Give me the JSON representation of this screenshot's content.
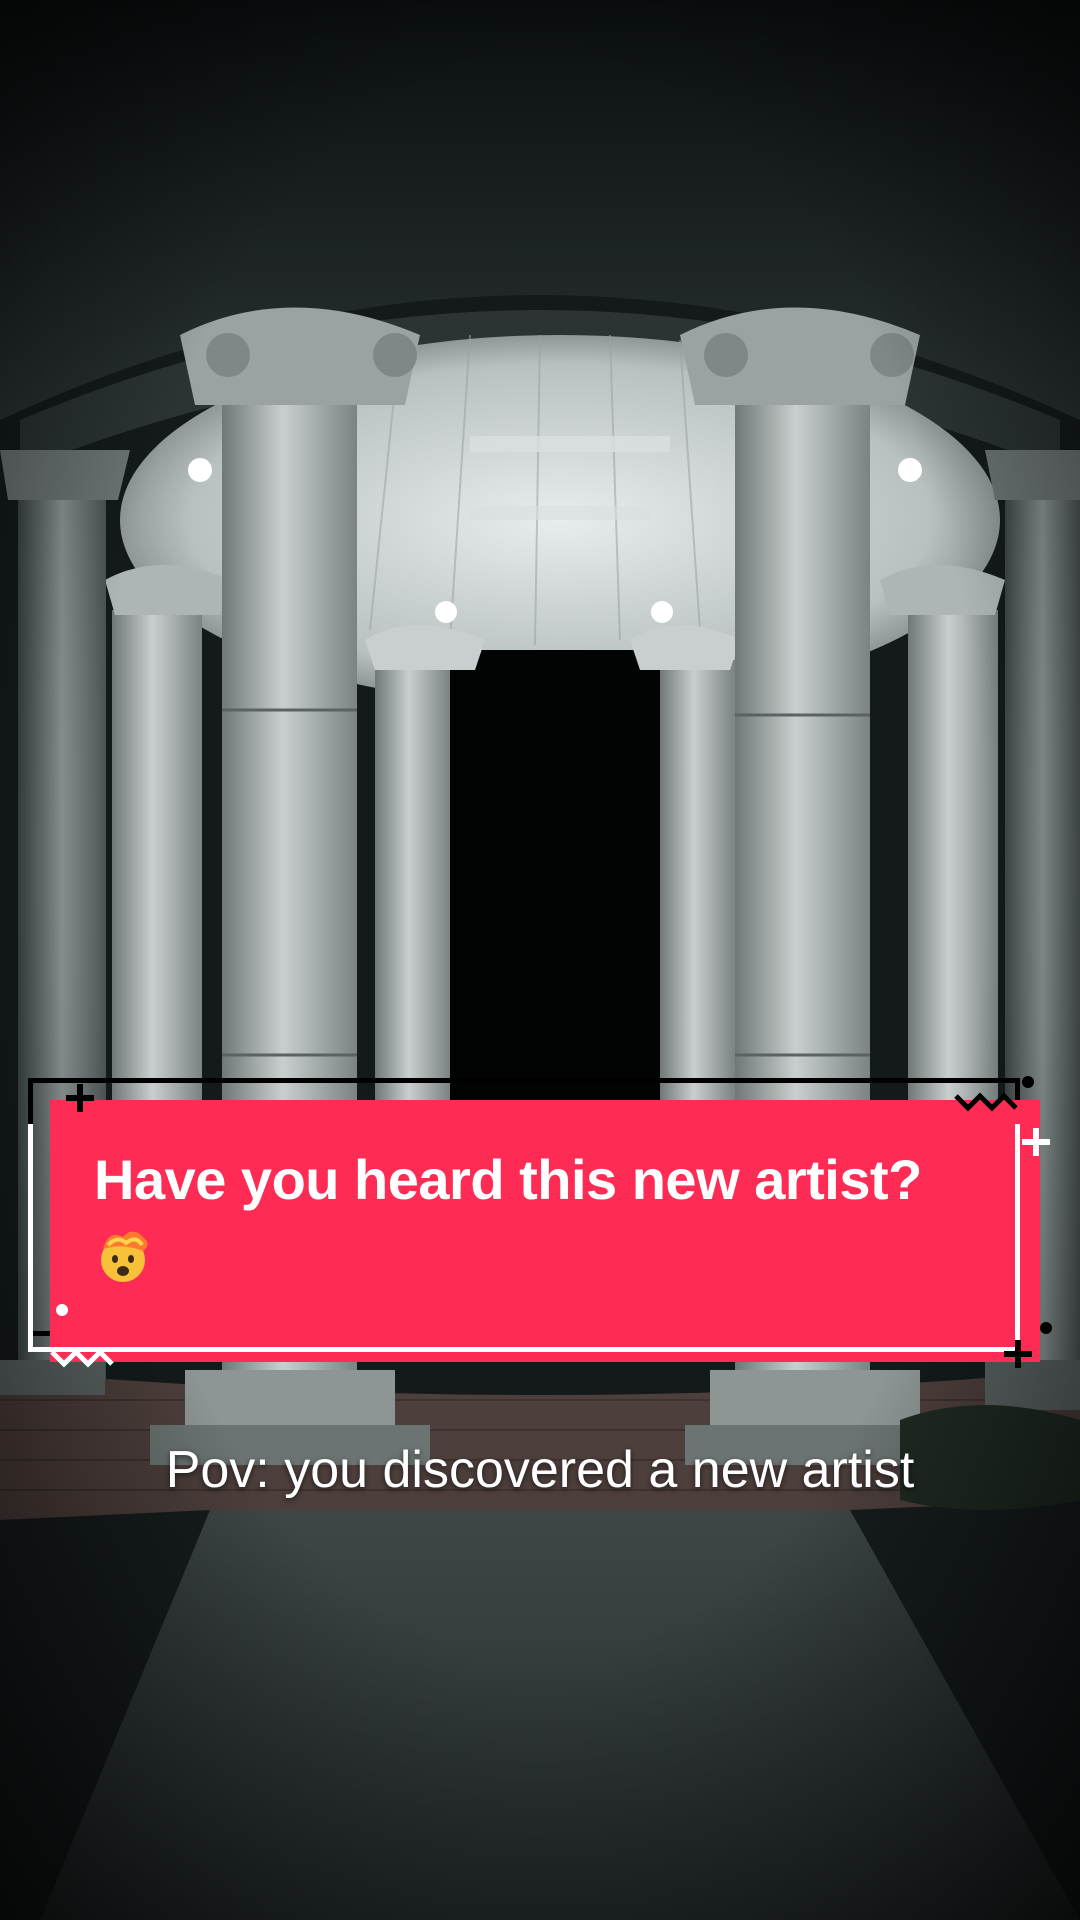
{
  "banner": {
    "text": "Have you heard this new artist?",
    "emoji_icon": "exploding-head-icon",
    "color": "#fe2c55"
  },
  "subtitle": {
    "text": "Pov: you discovered a new artist"
  }
}
